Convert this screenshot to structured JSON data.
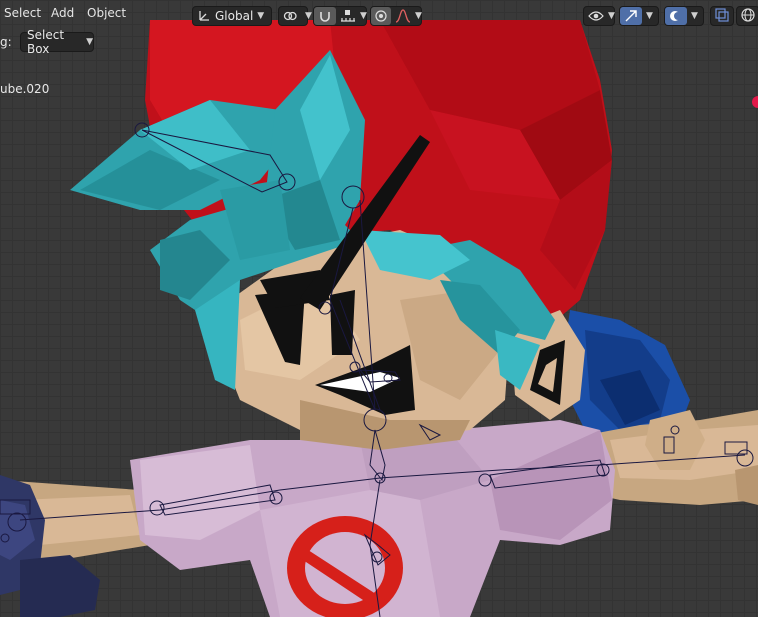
{
  "header": {
    "menu": [
      "Select",
      "Add",
      "Object"
    ],
    "orientation_value": "Global"
  },
  "tool_settings": {
    "drag_label_fragment": "g:",
    "select_mode": "Select Box"
  },
  "overlay": {
    "object_name_fragment": "ube.020"
  },
  "icons": {
    "transform_orientation": "axes-icon",
    "pivot": "pivot-icon",
    "snap": "magnet-icon",
    "snap_target": "snap-increment-icon",
    "proportional": "proportional-edit-icon",
    "falloff": "falloff-curve-icon",
    "visibility": "eye-icon",
    "gizmo": "gizmo-icon",
    "overlays": "overlays-icon",
    "xray": "xray-icon",
    "shading_wire": "wireframe-sphere-icon"
  },
  "colors": {
    "background": "#3a3a3a",
    "header_bg": "#282828",
    "active_blue": "#4f6fa8",
    "cap_red": "#c0101a",
    "hair_teal": "#2fa3ad",
    "skin": "#d9b896",
    "shirt": "#c8a8c8"
  }
}
